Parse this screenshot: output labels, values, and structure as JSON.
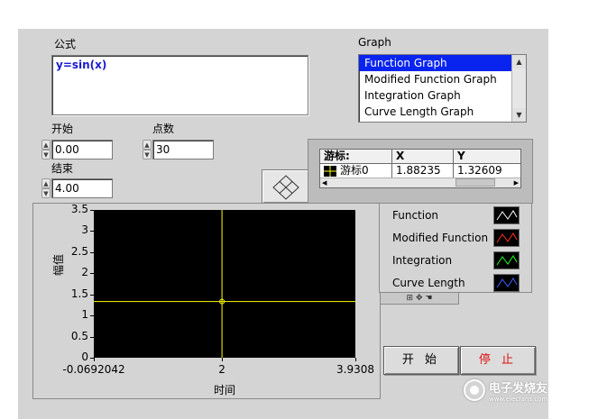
{
  "formula": {
    "label": "公式",
    "value": "y=sin(x)"
  },
  "graph_select": {
    "label": "Graph",
    "items": [
      "Function Graph",
      "Modified Function Graph",
      "Integration Graph",
      "Curve Length Graph"
    ],
    "selected_index": 0
  },
  "start_control": {
    "label": "开始",
    "value": "0.00"
  },
  "points_control": {
    "label": "点数",
    "value": "30"
  },
  "end_control": {
    "label": "结束",
    "value": "4.00"
  },
  "cursor_table": {
    "headers": [
      "游标:",
      "X",
      "Y"
    ],
    "row": {
      "name": "游标0",
      "x": "1.88235",
      "y": "1.32609"
    }
  },
  "plot": {
    "y_label": "幅值",
    "x_label": "时间",
    "y_ticks": [
      "3.5",
      "3",
      "2.5",
      "2",
      "1.5",
      "1",
      "0.5",
      "0"
    ],
    "x_ticks": [
      "-0.0692042",
      "2",
      "3.9308"
    ],
    "background": "#000000",
    "cursor_color": "#ffff00",
    "cursor_x_fraction": 0.49,
    "cursor_y_fraction": 0.62
  },
  "legend": [
    {
      "name": "Function",
      "color": "#ffffff"
    },
    {
      "name": "Modified Function",
      "color": "#ff3020"
    },
    {
      "name": "Integration",
      "color": "#20ff20"
    },
    {
      "name": "Curve Length",
      "color": "#4060ff"
    }
  ],
  "buttons": {
    "start": "开 始",
    "stop": "停 止"
  },
  "watermark": {
    "title": "电子发烧友",
    "subtitle": "www.elecfans.com"
  }
}
